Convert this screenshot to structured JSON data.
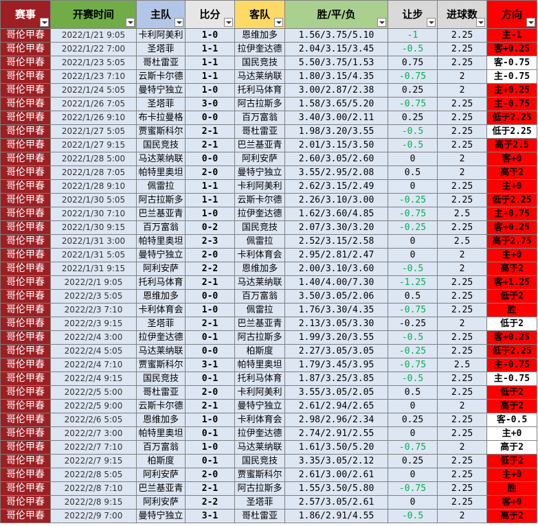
{
  "headers": {
    "league": "赛事",
    "time": "开赛时间",
    "home": "主队",
    "score": "比分",
    "away": "客队",
    "odds": "胜/平/负",
    "handicap": "让步",
    "goals": "进球数",
    "direction": "方向"
  },
  "colors": {
    "league_bg": "#9e1f23",
    "time_header_bg": "#70ad47",
    "home_header_bg": "#b4c6e7",
    "away_header_bg": "#ffd966",
    "odds_header_bg": "#a9d08e",
    "direction_hit": "#ff0000",
    "direction_miss": "#ffffff",
    "handicap_green": "#00b050",
    "row_bg": "#dde6f3"
  },
  "rows": [
    {
      "league": "哥伦甲春",
      "time": "2022/1/21 9:05",
      "home": "卡利阿美利",
      "score": "1-0",
      "away": "恩维加多",
      "odds": "1.56/3.75/5.10",
      "handicap": "-1",
      "hcp_green": true,
      "goals": "2.25",
      "direction": "主-1",
      "dir_hit": true
    },
    {
      "league": "哥伦甲春",
      "time": "2022/1/22 7:00",
      "home": "圣塔菲",
      "score": "1-1",
      "away": "拉伊奎达德",
      "odds": "2.04/3.15/3.45",
      "handicap": "-0.5",
      "hcp_green": true,
      "goals": "2.25",
      "direction": "客+0.25",
      "dir_hit": true
    },
    {
      "league": "哥伦甲春",
      "time": "2022/1/23 5:05",
      "home": "哥杜雷亚",
      "score": "1-1",
      "away": "国民竞技",
      "odds": "5.50/3.75/1.53",
      "handicap": "0.75",
      "hcp_green": false,
      "goals": "2.25",
      "direction": "客-0.75",
      "dir_hit": false
    },
    {
      "league": "哥伦甲春",
      "time": "2022/1/23 7:10",
      "home": "云斯卡尔德",
      "score": "1-1",
      "away": "马达莱纳联",
      "odds": "1.80/3.15/4.35",
      "handicap": "-0.75",
      "hcp_green": true,
      "goals": "2",
      "direction": "主-0.75",
      "dir_hit": false
    },
    {
      "league": "哥伦甲春",
      "time": "2022/1/24 5:05",
      "home": "曼特宁独立",
      "score": "1-0",
      "away": "托利马体育",
      "odds": "3.00/2.87/2.38",
      "handicap": "0.25",
      "hcp_green": false,
      "goals": "2",
      "direction": "主+0.25",
      "dir_hit": true
    },
    {
      "league": "哥伦甲春",
      "time": "2022/1/26 7:05",
      "home": "圣塔菲",
      "score": "3-0",
      "away": "阿古拉斯多",
      "odds": "1.58/3.65/5.20",
      "handicap": "-0.75",
      "hcp_green": true,
      "goals": "2.25",
      "direction": "主-0.75",
      "dir_hit": true
    },
    {
      "league": "哥伦甲春",
      "time": "2022/1/26 9:10",
      "home": "布卡拉曼格",
      "score": "0-0",
      "away": "百万富翁",
      "odds": "3.40/3.00/2.11",
      "handicap": "0.25",
      "hcp_green": false,
      "goals": "2.25",
      "direction": "低于2.25",
      "dir_hit": true
    },
    {
      "league": "哥伦甲春",
      "time": "2022/1/27 5:05",
      "home": "贾蜜斯科尔",
      "score": "2-1",
      "away": "哥杜雷亚",
      "odds": "1.98/3.20/3.55",
      "handicap": "-0.5",
      "hcp_green": true,
      "goals": "2.25",
      "direction": "低于2.25",
      "dir_hit": false
    },
    {
      "league": "哥伦甲春",
      "time": "2022/1/27 9:15",
      "home": "国民竞技",
      "score": "2-1",
      "away": "巴兰基亚青",
      "odds": "2.01/3.15/3.50",
      "handicap": "-0.5",
      "hcp_green": true,
      "goals": "2.25",
      "direction": "高于2.5",
      "dir_hit": true
    },
    {
      "league": "哥伦甲春",
      "time": "2022/1/28 5:00",
      "home": "马达莱纳联",
      "score": "0-0",
      "away": "阿利安萨",
      "odds": "2.60/3.05/2.60",
      "handicap": "0",
      "hcp_green": false,
      "goals": "2",
      "direction": "客+0",
      "dir_hit": true
    },
    {
      "league": "哥伦甲春",
      "time": "2022/1/28 7:05",
      "home": "帕特里奥坦",
      "score": "2-0",
      "away": "曼特宁独立",
      "odds": "3.55/2.95/2.08",
      "handicap": "0.5",
      "hcp_green": false,
      "goals": "2",
      "direction": "高于2",
      "dir_hit": true
    },
    {
      "league": "哥伦甲春",
      "time": "2022/1/28 9:10",
      "home": "佩雷拉",
      "score": "1-1",
      "away": "卡利阿美利",
      "odds": "2.62/3.15/2.49",
      "handicap": "0",
      "hcp_green": false,
      "goals": "2.25",
      "direction": "主+0",
      "dir_hit": true
    },
    {
      "league": "哥伦甲春",
      "time": "2022/1/30 5:05",
      "home": "阿古拉斯多",
      "score": "1-1",
      "away": "云斯卡尔德",
      "odds": "2.26/3.10/3.00",
      "handicap": "-0.25",
      "hcp_green": true,
      "goals": "2.25",
      "direction": "低于2.25",
      "dir_hit": true
    },
    {
      "league": "哥伦甲春",
      "time": "2022/1/30 7:10",
      "home": "巴兰基亚青",
      "score": "1-0",
      "away": "拉伊奎达德",
      "odds": "1.62/3.60/4.85",
      "handicap": "-0.75",
      "hcp_green": true,
      "goals": "2.5",
      "direction": "主-0.75",
      "dir_hit": true
    },
    {
      "league": "哥伦甲春",
      "time": "2022/1/30 9:15",
      "home": "百万富翁",
      "score": "0-2",
      "away": "国民竞技",
      "odds": "2.07/3.30/3.20",
      "handicap": "-0.25",
      "hcp_green": true,
      "goals": "2.25",
      "direction": "客+0.25",
      "dir_hit": true
    },
    {
      "league": "哥伦甲春",
      "time": "2022/1/31 3:00",
      "home": "帕特里奥坦",
      "score": "2-3",
      "away": "佩雷拉",
      "odds": "2.52/3.15/2.58",
      "handicap": "0",
      "hcp_green": false,
      "goals": "2.5",
      "direction": "高于2.75",
      "dir_hit": true
    },
    {
      "league": "哥伦甲春",
      "time": "2022/1/31 5:05",
      "home": "曼特宁独立",
      "score": "2-0",
      "away": "卡利体育会",
      "odds": "2.95/2.81/2.47",
      "handicap": "0",
      "hcp_green": false,
      "goals": "2",
      "direction": "主+0",
      "dir_hit": true
    },
    {
      "league": "哥伦甲春",
      "time": "2022/1/31 9:15",
      "home": "阿利安萨",
      "score": "2-2",
      "away": "恩维加多",
      "odds": "2.00/3.10/3.60",
      "handicap": "-0.5",
      "hcp_green": true,
      "goals": "2",
      "direction": "高于2",
      "dir_hit": true
    },
    {
      "league": "哥伦甲春",
      "time": "2022/2/1 9:05",
      "home": "托利马体育",
      "score": "2-1",
      "away": "马达莱纳联",
      "odds": "1.40/4.00/7.30",
      "handicap": "-1.25",
      "hcp_green": true,
      "goals": "2.25",
      "direction": "客+1.25",
      "dir_hit": true
    },
    {
      "league": "哥伦甲春",
      "time": "2022/2/3 5:05",
      "home": "恩维加多",
      "score": "0-0",
      "away": "百万富翁",
      "odds": "3.50/3.05/2.06",
      "handicap": "0.5",
      "hcp_green": false,
      "goals": "2.25",
      "direction": "低于2",
      "dir_hit": true
    },
    {
      "league": "哥伦甲春",
      "time": "2022/2/3 7:10",
      "home": "卡利体育会",
      "score": "1-0",
      "away": "佩雷拉",
      "odds": "1.76/3.30/4.35",
      "handicap": "-0.75",
      "hcp_green": true,
      "goals": "2.25",
      "direction": "胜",
      "dir_hit": true
    },
    {
      "league": "哥伦甲春",
      "time": "2022/2/3 9:15",
      "home": "圣塔菲",
      "score": "2-1",
      "away": "巴兰基亚青",
      "odds": "2.13/3.05/3.30",
      "handicap": "-0.25",
      "hcp_green": false,
      "goals": "2",
      "direction": "低于2",
      "dir_hit": false
    },
    {
      "league": "哥伦甲春",
      "time": "2022/2/4 3:00",
      "home": "拉伊奎达德",
      "score": "0-1",
      "away": "阿古拉斯多",
      "odds": "1.99/3.20/3.55",
      "handicap": "-0.5",
      "hcp_green": true,
      "goals": "2.25",
      "direction": "客+0.25",
      "dir_hit": true
    },
    {
      "league": "哥伦甲春",
      "time": "2022/2/4 5:05",
      "home": "马达莱纳联",
      "score": "0-0",
      "away": "柏斯度",
      "odds": "2.27/3.05/3.05",
      "handicap": "-0.25",
      "hcp_green": true,
      "goals": "2.25",
      "direction": "低于2.25",
      "dir_hit": true
    },
    {
      "league": "哥伦甲春",
      "time": "2022/2/4 7:10",
      "home": "贾蜜斯科尔",
      "score": "3-1",
      "away": "帕特里奥坦",
      "odds": "1.79/3.45/3.95",
      "handicap": "-0.75",
      "hcp_green": true,
      "goals": "2.5",
      "direction": "主-0.75",
      "dir_hit": true
    },
    {
      "league": "哥伦甲春",
      "time": "2022/2/4 9:15",
      "home": "国民竞技",
      "score": "0-1",
      "away": "托利马体育",
      "odds": "1.87/3.25/3.85",
      "handicap": "-0.5",
      "hcp_green": true,
      "goals": "2.25",
      "direction": "主-0.75",
      "dir_hit": false
    },
    {
      "league": "哥伦甲春",
      "time": "2022/2/5 5:00",
      "home": "哥杜雷亚",
      "score": "2-0",
      "away": "卡利阿美利",
      "odds": "3.55/3.05/2.05",
      "handicap": "0.5",
      "hcp_green": false,
      "goals": "2.25",
      "direction": "低于2",
      "dir_hit": true
    },
    {
      "league": "哥伦甲春",
      "time": "2022/2/5 9:00",
      "home": "云斯卡尔德",
      "score": "2-1",
      "away": "曼特宁独立",
      "odds": "2.61/2.94/2.65",
      "handicap": "0",
      "hcp_green": false,
      "goals": "2",
      "direction": "高于2",
      "dir_hit": true
    },
    {
      "league": "哥伦甲春",
      "time": "2022/2/6 5:05",
      "home": "恩维加多",
      "score": "1-0",
      "away": "卡利体育会",
      "odds": "2.98/2.96/2.34",
      "handicap": "0.25",
      "hcp_green": false,
      "goals": "2.25",
      "direction": "客-0.5",
      "dir_hit": false
    },
    {
      "league": "哥伦甲春",
      "time": "2022/2/7 3:00",
      "home": "帕特里奥坦",
      "score": "0-1",
      "away": "拉伊奎达德",
      "odds": "2.74/2.91/2.55",
      "handicap": "0",
      "hcp_green": false,
      "goals": "2.25",
      "direction": "主+0",
      "dir_hit": false
    },
    {
      "league": "哥伦甲春",
      "time": "2022/2/7 7:10",
      "home": "百万富翁",
      "score": "1-0",
      "away": "马达莱纳联",
      "odds": "1.61/3.50/5.20",
      "handicap": "-0.75",
      "hcp_green": true,
      "goals": "2",
      "direction": "高于2",
      "dir_hit": false
    },
    {
      "league": "哥伦甲春",
      "time": "2022/2/7 9:15",
      "home": "柏斯度",
      "score": "0-1",
      "away": "国民竞技",
      "odds": "3.35/3.05/2.12",
      "handicap": "0.25",
      "hcp_green": false,
      "goals": "2.25",
      "direction": "低于2",
      "dir_hit": true
    },
    {
      "league": "哥伦甲春",
      "time": "2022/2/8 5:05",
      "home": "阿利安萨",
      "score": "2-0",
      "away": "贾蜜斯科尔",
      "odds": "2.61/3.00/2.61",
      "handicap": "0",
      "hcp_green": false,
      "goals": "2.25",
      "direction": "主+0",
      "dir_hit": true
    },
    {
      "league": "哥伦甲春",
      "time": "2022/2/8 7:10",
      "home": "巴兰基亚青",
      "score": "2-1",
      "away": "阿古拉斯多",
      "odds": "1.55/3.50/5.80",
      "handicap": "-0.75",
      "hcp_green": true,
      "goals": "2.25",
      "direction": "胜",
      "dir_hit": true
    },
    {
      "league": "哥伦甲春",
      "time": "2022/2/8 9:15",
      "home": "阿利安萨",
      "score": "2-2",
      "away": "圣塔菲",
      "odds": "2.57/3.05/2.61",
      "handicap": "0",
      "hcp_green": false,
      "goals": "2.25",
      "direction": "客+0",
      "dir_hit": true
    },
    {
      "league": "哥伦甲春",
      "time": "2022/2/9 7:00",
      "home": "曼特宁独立",
      "score": "3-1",
      "away": "哥杜雷亚",
      "odds": "1.86/2.91/4.55",
      "handicap": "-0.5",
      "hcp_green": true,
      "goals": "2",
      "direction": "高于2",
      "dir_hit": true
    }
  ]
}
